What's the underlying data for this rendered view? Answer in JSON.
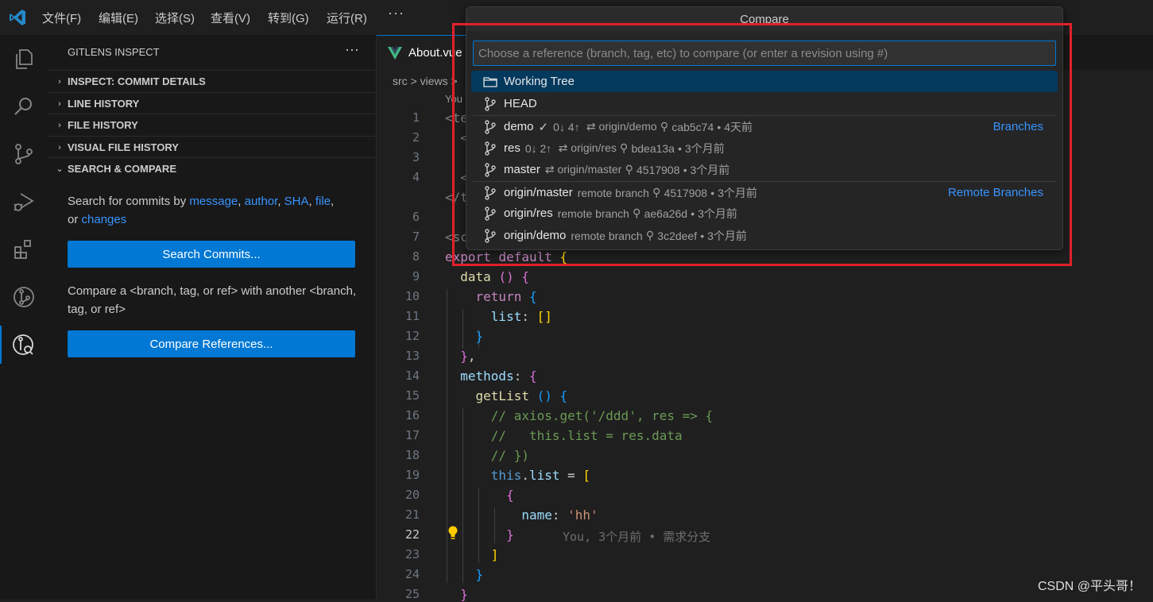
{
  "menubar": {
    "items": [
      "文件(F)",
      "编辑(E)",
      "选择(S)",
      "查看(V)",
      "转到(G)",
      "运行(R)"
    ],
    "more": "···"
  },
  "activity_bar": {
    "icons": [
      "explorer-icon",
      "search-icon",
      "source-control-icon",
      "run-debug-icon",
      "extensions-icon",
      "gitlens-icon",
      "gitlens-inspect-icon"
    ],
    "active": "gitlens-inspect-icon"
  },
  "sidebar": {
    "header": "GITLENS INSPECT",
    "more": "···",
    "sections": [
      {
        "label": "INSPECT: COMMIT DETAILS",
        "chevron": "›"
      },
      {
        "label": "LINE HISTORY",
        "chevron": "›"
      },
      {
        "label": "FILE HISTORY",
        "chevron": "›"
      },
      {
        "label": "VISUAL FILE HISTORY",
        "chevron": "›"
      },
      {
        "label": "SEARCH & COMPARE",
        "chevron": "⌄"
      }
    ],
    "search_desc": {
      "prefix": "Search for commits by ",
      "message": "message",
      "sep1": ", ",
      "author": "author",
      "sep2": ", ",
      "sha": "SHA",
      "sep3": ", ",
      "file": "file",
      "sep4": ",",
      "or": "or ",
      "changes": "changes"
    },
    "search_button": "Search Commits...",
    "compare_desc": "Compare a <branch, tag, or ref> with another <branch, tag, or ref>",
    "compare_button": "Compare References..."
  },
  "editor": {
    "tab": "About.vue",
    "breadcrumb": [
      "src",
      ">",
      "views",
      ">"
    ],
    "codelens": "You",
    "line_numbers": [
      "1",
      "2",
      "3",
      "4",
      "5",
      "6",
      "7",
      "8",
      "9",
      "10",
      "11",
      "12",
      "13",
      "14",
      "15",
      "16",
      "17",
      "18",
      "19",
      "20",
      "21",
      "22",
      "23",
      "24",
      "25"
    ],
    "current_line": "22",
    "blame": "You, 3个月前 • 需求分支"
  },
  "quickpick": {
    "title": "Compare",
    "placeholder": "Choose a reference (branch, tag, etc) to compare (or enter a revision using #)",
    "items": [
      {
        "label": "Working Tree",
        "icon": "folder-icon",
        "desc": "",
        "group": ""
      },
      {
        "label": "HEAD",
        "icon": "branch-icon",
        "desc": "",
        "group": ""
      },
      {
        "label": "demo",
        "icon": "branch-icon",
        "check": "✓",
        "status": "0↓ 4↑",
        "upstream": "⇄ origin/demo",
        "commit": "cab5c74",
        "age": "• 4天前",
        "group": "Branches"
      },
      {
        "label": "res",
        "icon": "branch-icon",
        "status": "0↓ 2↑",
        "upstream": "⇄ origin/res",
        "commit": "bdea13a",
        "age": "• 3个月前",
        "group": ""
      },
      {
        "label": "master",
        "icon": "branch-icon",
        "status": "",
        "upstream": "⇄ origin/master",
        "commit": "4517908",
        "age": "• 3个月前",
        "group": ""
      },
      {
        "label": "origin/master",
        "icon": "branch-icon",
        "status": "",
        "upstream": "remote branch",
        "commit": "4517908",
        "age": "• 3个月前",
        "group": "Remote Branches"
      },
      {
        "label": "origin/res",
        "icon": "branch-icon",
        "status": "",
        "upstream": "remote branch",
        "commit": "ae6a26d",
        "age": "• 3个月前",
        "group": ""
      },
      {
        "label": "origin/demo",
        "icon": "branch-icon",
        "status": "",
        "upstream": "remote branch",
        "commit": "3c2deef",
        "age": "• 3个月前",
        "group": ""
      }
    ]
  },
  "watermark": "CSDN @平头哥！",
  "colors": {
    "accent": "#0078d4",
    "link": "#3794ff",
    "selection": "#04395e",
    "annotation_box": "#e0212a"
  }
}
